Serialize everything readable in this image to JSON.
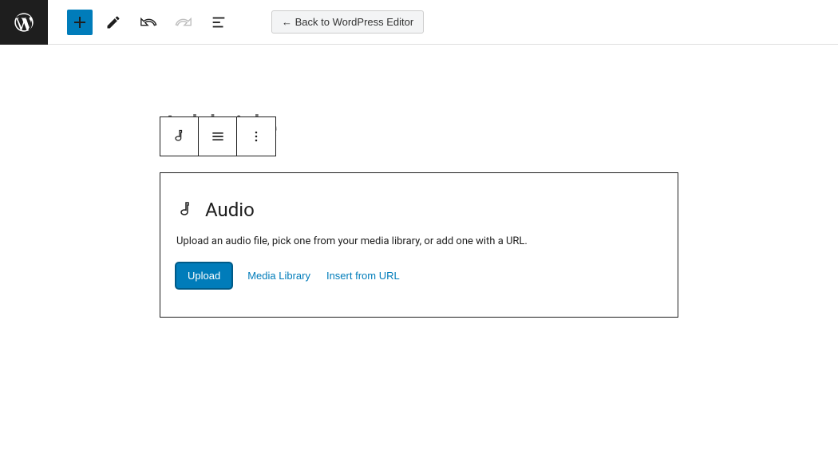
{
  "header": {
    "back_label": "← Back to WordPress Editor"
  },
  "editor": {
    "title_placeholder": "Add title"
  },
  "block": {
    "type_label": "Audio",
    "description": "Upload an audio file, pick one from your media library, or add one with a URL.",
    "upload_label": "Upload",
    "media_library_label": "Media Library",
    "insert_url_label": "Insert from URL"
  }
}
